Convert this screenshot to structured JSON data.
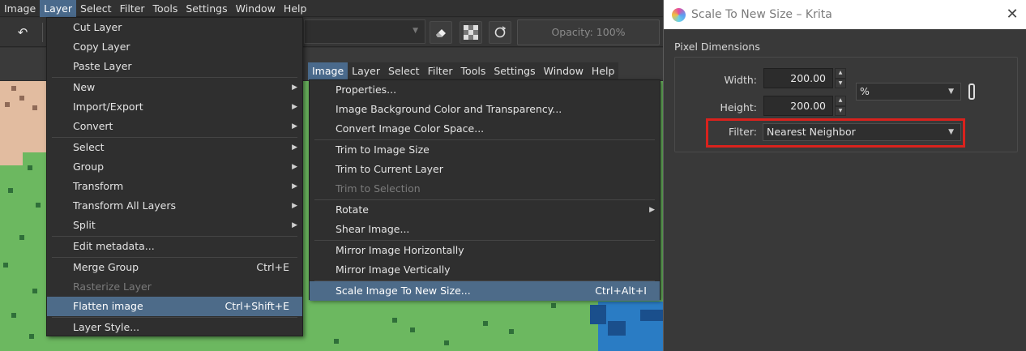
{
  "menubar": [
    "Image",
    "Layer",
    "Select",
    "Filter",
    "Tools",
    "Settings",
    "Window",
    "Help"
  ],
  "menubar_active": "Layer",
  "toolbar": {
    "opacity_label": "Opacity: 100%",
    "icons": [
      "undo-icon",
      "eraser-icon",
      "alpha-lock-icon",
      "reload-icon"
    ]
  },
  "docker_menubar": [
    "Image",
    "Layer",
    "Select",
    "Filter",
    "Tools",
    "Settings",
    "Window",
    "Help"
  ],
  "layer_menu": {
    "items": [
      {
        "label": "Cut Layer",
        "shortcut": "",
        "submenu": false,
        "disabled": false
      },
      {
        "label": "Copy Layer",
        "shortcut": "",
        "submenu": false,
        "disabled": false
      },
      {
        "label": "Paste Layer",
        "shortcut": "",
        "submenu": false,
        "disabled": false
      },
      {
        "label": "New",
        "shortcut": "",
        "submenu": true,
        "disabled": false
      },
      {
        "label": "Import/Export",
        "shortcut": "",
        "submenu": true,
        "disabled": false
      },
      {
        "label": "Convert",
        "shortcut": "",
        "submenu": true,
        "disabled": false
      },
      {
        "label": "Select",
        "shortcut": "",
        "submenu": true,
        "disabled": false
      },
      {
        "label": "Group",
        "shortcut": "",
        "submenu": true,
        "disabled": false
      },
      {
        "label": "Transform",
        "shortcut": "",
        "submenu": true,
        "disabled": false
      },
      {
        "label": "Transform All Layers",
        "shortcut": "",
        "submenu": true,
        "disabled": false
      },
      {
        "label": "Split",
        "shortcut": "",
        "submenu": true,
        "disabled": false
      },
      {
        "label": "Edit metadata...",
        "shortcut": "",
        "submenu": false,
        "disabled": false
      },
      {
        "label": "Merge Group",
        "shortcut": "Ctrl+E",
        "submenu": false,
        "disabled": false
      },
      {
        "label": "Rasterize Layer",
        "shortcut": "",
        "submenu": false,
        "disabled": true
      },
      {
        "label": "Flatten image",
        "shortcut": "Ctrl+Shift+E",
        "submenu": false,
        "disabled": false,
        "highlighted": true
      },
      {
        "label": "Layer Style...",
        "shortcut": "",
        "submenu": false,
        "disabled": false
      }
    ]
  },
  "image_menu": {
    "items": [
      {
        "label": "Properties...",
        "shortcut": "",
        "submenu": false,
        "disabled": false
      },
      {
        "label": "Image Background Color and Transparency...",
        "shortcut": "",
        "submenu": false,
        "disabled": false
      },
      {
        "label": "Convert Image Color Space...",
        "shortcut": "",
        "submenu": false,
        "disabled": false
      },
      {
        "label": "Trim to Image Size",
        "shortcut": "",
        "submenu": false,
        "disabled": false
      },
      {
        "label": "Trim to Current Layer",
        "shortcut": "",
        "submenu": false,
        "disabled": false
      },
      {
        "label": "Trim to Selection",
        "shortcut": "",
        "submenu": false,
        "disabled": true
      },
      {
        "label": "Rotate",
        "shortcut": "",
        "submenu": true,
        "disabled": false
      },
      {
        "label": "Shear Image...",
        "shortcut": "",
        "submenu": false,
        "disabled": false
      },
      {
        "label": "Mirror Image Horizontally",
        "shortcut": "",
        "submenu": false,
        "disabled": false
      },
      {
        "label": "Mirror Image Vertically",
        "shortcut": "",
        "submenu": false,
        "disabled": false
      },
      {
        "label": "Scale Image To New Size...",
        "shortcut": "Ctrl+Alt+I",
        "submenu": false,
        "disabled": false,
        "highlighted": true
      }
    ]
  },
  "dialog": {
    "title": "Scale To New Size – Krita",
    "group_label": "Pixel Dimensions",
    "width_label": "Width:",
    "width_value": "200.00",
    "height_label": "Height:",
    "height_value": "200.00",
    "unit": "%",
    "filter_label": "Filter:",
    "filter_value": "Nearest Neighbor",
    "highlight_color": "#d9221d"
  }
}
